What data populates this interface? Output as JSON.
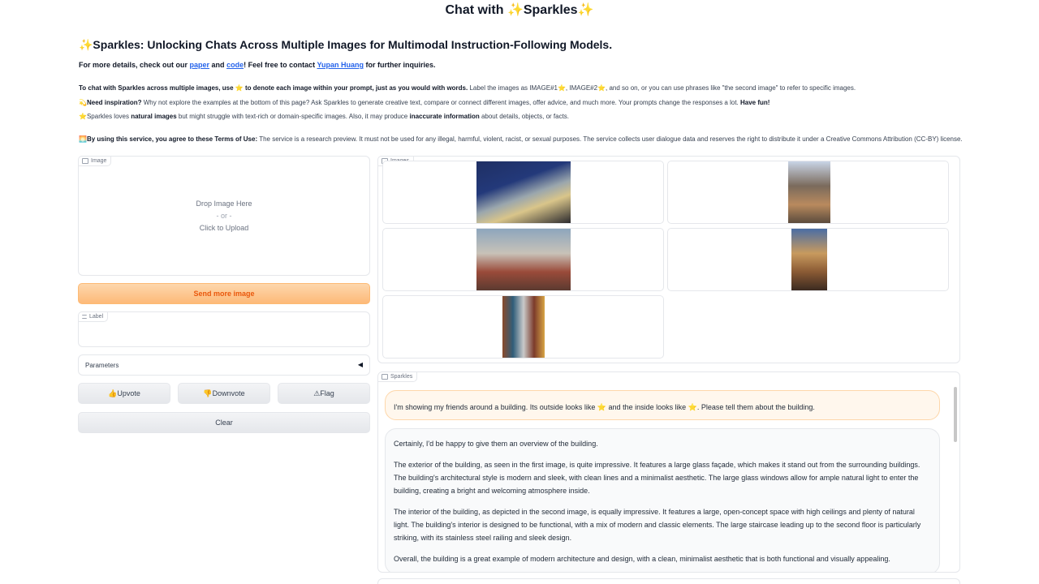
{
  "page": {
    "title": "Chat with ✨Sparkles✨"
  },
  "intro": {
    "headline": "✨Sparkles: Unlocking Chats Across Multiple Images for Multimodal Instruction-Following Models.",
    "details_prefix": "For more details, check out our ",
    "paper_link": "paper",
    "and": " and ",
    "code_link": "code",
    "contact_mid": "! Feel free to contact ",
    "author_link": "Yupan Huang",
    "details_suffix": " for further inquiries.",
    "usage_bold": "To chat with Sparkles across multiple images, use ⭐ to denote each image within your prompt, just as you would with words.",
    "usage_rest": " Label the images as IMAGE#1⭐, IMAGE#2⭐, and so on, or you can use phrases like \"the second image\" to refer to specific images.",
    "inspire_bold": "💫Need inspiration?",
    "inspire_rest": " Why not explore the examples at the bottom of this page? Ask Sparkles to generate creative text, compare or connect different images, offer advice, and much more. Your prompts change the responses a lot. ",
    "inspire_fun": "Have fun!",
    "loves_a": "⭐Sparkles loves ",
    "loves_bold": "natural images",
    "loves_b": " but might struggle with text-rich or domain-specific images. Also, it may produce ",
    "loves_bold2": "inaccurate information",
    "loves_c": " about details, objects, or facts.",
    "terms_bold": "🌅By using this service, you agree to these Terms of Use:",
    "terms_rest": " The service is a research preview. It must not be used for any illegal, harmful, violent, racist, or sexual purposes. The service collects user dialogue data and reserves the right to distribute it under a Creative Commons Attribution (CC-BY) license."
  },
  "left": {
    "image_tag": "Image",
    "drop_text": "Drop Image Here",
    "or_text": "- or -",
    "click_text": "Click to Upload",
    "send_button": "Send more image",
    "label_tag": "Label",
    "parameters": "Parameters",
    "parameters_arrow": "◀",
    "upvote": "👍Upvote",
    "downvote": "👎Downvote",
    "flag": "⚠Flag",
    "clear": "Clear"
  },
  "gallery": {
    "tag": "Images"
  },
  "chat": {
    "tag": "Sparkles",
    "user_message": "I'm showing my friends around a building. Its outside looks like ⭐ and the inside looks like ⭐. Please tell them about the building.",
    "bot_paragraphs": [
      "Certainly, I'd be happy to give them an overview of the building.",
      "The exterior of the building, as seen in the first image, is quite impressive. It features a large glass façade, which makes it stand out from the surrounding buildings. The building's architectural style is modern and sleek, with clean lines and a minimalist aesthetic. The large glass windows allow for ample natural light to enter the building, creating a bright and welcoming atmosphere inside.",
      "The interior of the building, as depicted in the second image, is equally impressive. It features a large, open-concept space with high ceilings and plenty of natural light. The building's interior is designed to be functional, with a mix of modern and classic elements. The large staircase leading up to the second floor is particularly striking, with its stainless steel railing and sleek design.",
      "Overall, the building is a great example of modern architecture and design, with a clean, minimalist aesthetic that is both functional and visually appealing."
    ]
  },
  "colors": {
    "primary_button": "#fdba74",
    "primary_text": "#ea580c",
    "user_bubble": "#fff7ed",
    "bot_bubble": "#f9fafb",
    "link": "#2563eb"
  }
}
